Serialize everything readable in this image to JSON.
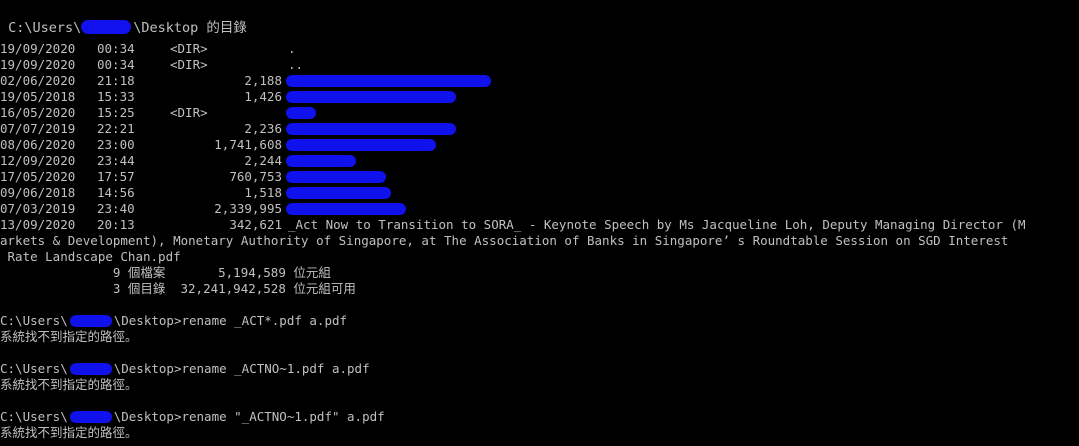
{
  "header": {
    "prefix": " C:\\Users\\",
    "suffix": "\\Desktop 的目錄"
  },
  "dir_entries": [
    {
      "date": "19/09/2020",
      "time": "00:34",
      "type": "<DIR>",
      "size": "",
      "name": "."
    },
    {
      "date": "19/09/2020",
      "time": "00:34",
      "type": "<DIR>",
      "size": "",
      "name": ".."
    },
    {
      "date": "02/06/2020",
      "time": "21:18",
      "type": "",
      "size": "2,188",
      "name": ""
    },
    {
      "date": "19/05/2018",
      "time": "15:33",
      "type": "",
      "size": "1,426",
      "name": ""
    },
    {
      "date": "16/05/2020",
      "time": "15:25",
      "type": "<DIR>",
      "size": "",
      "name": ""
    },
    {
      "date": "07/07/2019",
      "time": "22:21",
      "type": "",
      "size": "2,236",
      "name": ""
    },
    {
      "date": "08/06/2020",
      "time": "23:00",
      "type": "",
      "size": "1,741,608",
      "name": ""
    },
    {
      "date": "12/09/2020",
      "time": "23:44",
      "type": "",
      "size": "2,244",
      "name": ""
    },
    {
      "date": "17/05/2020",
      "time": "17:57",
      "type": "",
      "size": "760,753",
      "name": ""
    },
    {
      "date": "09/06/2018",
      "time": "14:56",
      "type": "",
      "size": "1,518",
      "name": ""
    },
    {
      "date": "07/03/2019",
      "time": "23:40",
      "type": "",
      "size": "2,339,995",
      "name": ""
    },
    {
      "date": "13/09/2020",
      "time": "20:13",
      "type": "",
      "size": "342,621",
      "name": "_Act Now to Transition to SORA_ - Keynote Speech by Ms Jacqueline Loh, Deputy Managing Director (M"
    }
  ],
  "long_name_wrap": [
    "arkets & Development), Monetary Authority of Singapore, at The Association of Banks in Singapore’ s Roundtable Session on SGD Interest",
    " Rate Landscape Chan.pdf"
  ],
  "summary": {
    "files_line": "               9 個檔案       5,194,589 位元組",
    "dirs_line": "               3 個目錄  32,241,942,528 位元組可用"
  },
  "commands": [
    {
      "prompt_prefix": "C:\\Users\\",
      "prompt_suffix": "\\Desktop>",
      "command": "rename _ACT*.pdf a.pdf",
      "output": "系統找不到指定的路徑。"
    },
    {
      "prompt_prefix": "C:\\Users\\",
      "prompt_suffix": "\\Desktop>",
      "command": "rename _ACTNO~1.pdf a.pdf",
      "output": "系統找不到指定的路徑。"
    },
    {
      "prompt_prefix": "C:\\Users\\",
      "prompt_suffix": "\\Desktop>",
      "command": "rename \"_ACTNO~1.pdf\" a.pdf",
      "output": "系統找不到指定的路徑。"
    }
  ],
  "colors": {
    "background": "#000000",
    "text": "#c0c0c0",
    "redaction": "#1111ee"
  }
}
